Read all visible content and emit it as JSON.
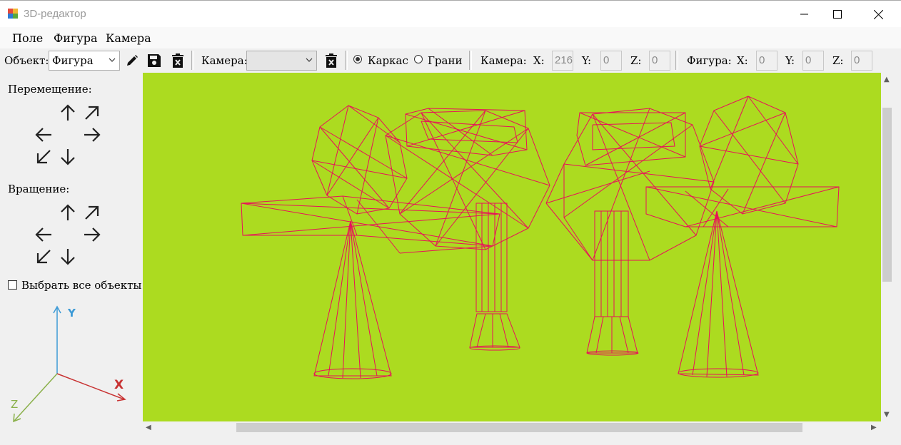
{
  "window": {
    "title": "3D-редактор",
    "minimize_icon": "minimize-icon",
    "maximize_icon": "maximize-icon",
    "close_icon": "close-icon"
  },
  "menu": [
    "Поле",
    "Фигура",
    "Камера"
  ],
  "toolbar": {
    "object_label": "Объект:",
    "object_value": "Фигура",
    "edit_icon": "pencil-icon",
    "save_icon": "floppy-disk-icon",
    "delete_icon": "trash-icon",
    "camera_label": "Камера:",
    "camera_value": "",
    "camera_delete_icon": "trash-icon",
    "mode_wireframe": "Каркас",
    "mode_faces": "Грани",
    "mode_selected": "Каркас",
    "camera_coords_label": "Камера:",
    "camera_x_label": "X:",
    "camera_x": "216",
    "camera_y_label": "Y:",
    "camera_y": "0",
    "camera_z_label": "Z:",
    "camera_z": "0",
    "figure_coords_label": "Фигура:",
    "figure_x_label": "X:",
    "figure_x": "0",
    "figure_y_label": "Y:",
    "figure_y": "0",
    "figure_z_label": "Z:",
    "figure_z": "0"
  },
  "left_panel": {
    "move_label": "Перемещение:",
    "rotate_label": "Вращение:",
    "select_all_label": "Выбрать все объекты",
    "select_all_checked": false,
    "axes": {
      "x": "X",
      "y": "Y",
      "z": "Z",
      "x_color": "#c83232",
      "y_color": "#3c9ad6",
      "z_color": "#8ab04a"
    }
  },
  "viewport": {
    "background": "#acdb20",
    "wire_color": "#e8105a"
  }
}
